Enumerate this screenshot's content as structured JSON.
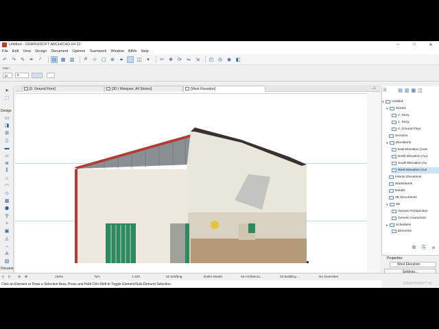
{
  "window": {
    "title": "Untitled - GRAPHISOFT ARCHICAD-64 22",
    "min": "─",
    "max": "□",
    "close": "✕"
  },
  "menu": [
    "File",
    "Edit",
    "View",
    "Design",
    "Document",
    "Options",
    "Teamwork",
    "Window",
    "BIMx",
    "Help"
  ],
  "infobox": {
    "label": "Main:",
    "field_a": "pt",
    "field_b": "▾"
  },
  "toolbox": {
    "design_label": "Design",
    "docu_label": "Docume"
  },
  "tabs": [
    {
      "label": "[0. Ground Floor]"
    },
    {
      "label": "[3D / Marquee, All Stories]"
    },
    {
      "label": "[West Elevation]"
    }
  ],
  "navigator": {
    "items": [
      {
        "label": "Untitled",
        "level": 0,
        "arrow": "▾"
      },
      {
        "label": "Stories",
        "level": 1,
        "arrow": "▾"
      },
      {
        "label": "2. Story",
        "level": 2,
        "arrow": ""
      },
      {
        "label": "1. Story",
        "level": 2,
        "arrow": ""
      },
      {
        "label": "0. Ground Floor",
        "level": 2,
        "arrow": ""
      },
      {
        "label": "Sections",
        "level": 1,
        "arrow": ""
      },
      {
        "label": "Elevations",
        "level": 1,
        "arrow": "▾"
      },
      {
        "label": "East Elevation (Auto",
        "level": 2,
        "arrow": ""
      },
      {
        "label": "North Elevation (Aut",
        "level": 2,
        "arrow": ""
      },
      {
        "label": "South Elevation (Au",
        "level": 2,
        "arrow": ""
      },
      {
        "label": "West Elevation (Aut",
        "level": 2,
        "arrow": "",
        "selected": true
      },
      {
        "label": "Interior Elevations",
        "level": 1,
        "arrow": ""
      },
      {
        "label": "Worksheets",
        "level": 1,
        "arrow": ""
      },
      {
        "label": "Details",
        "level": 1,
        "arrow": ""
      },
      {
        "label": "3D Documents",
        "level": 1,
        "arrow": ""
      },
      {
        "label": "3D",
        "level": 1,
        "arrow": "▾"
      },
      {
        "label": "Generic Perspective",
        "level": 2,
        "arrow": ""
      },
      {
        "label": "Generic Axonometr",
        "level": 2,
        "arrow": ""
      },
      {
        "label": "Schedules",
        "level": 1,
        "arrow": "▸"
      },
      {
        "label": "Elements",
        "level": 2,
        "arrow": ""
      }
    ]
  },
  "properties": {
    "title": "Properties",
    "name": "West Elevation",
    "settings": "Settings..."
  },
  "status": {
    "zoom": "183%",
    "angle": "N/A",
    "scale": "1:100",
    "layer": "02 Drafting",
    "model": "Entire Model",
    "arch": "03 Architectu...",
    "building": "03 Building ...",
    "overrides": "No Overrides"
  },
  "hint": "Click an Element or Draw a Selection Area. Press and Hold Ctrl+Shift to Toggle Element/Sub-Element Selection.",
  "brand": "GRAPHISOFT ID",
  "colors": {
    "accent": "#2a5ea8",
    "selection": "#cde3f7",
    "guide_line": "#b9dae8",
    "roof_red": "#b53a34",
    "door_green": "#2e8a5e"
  }
}
